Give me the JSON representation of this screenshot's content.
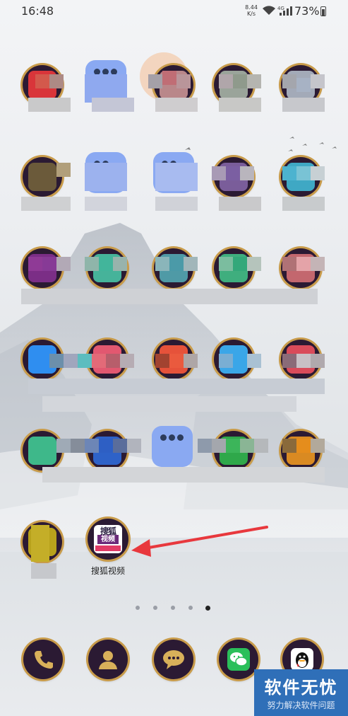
{
  "status_bar": {
    "time": "16:48",
    "net_speed_value": "8.44",
    "net_speed_unit": "K/s",
    "network": "4G",
    "battery": "73%"
  },
  "home": {
    "highlighted_app": {
      "label": "搜狐视频",
      "icon_text_top": "搜狐",
      "icon_text_mid": "视频"
    },
    "page_indicator": {
      "count": 5,
      "active_index": 5
    }
  },
  "dock": {
    "items": [
      {
        "name": "phone-icon"
      },
      {
        "name": "contacts-icon"
      },
      {
        "name": "messages-icon"
      },
      {
        "name": "wechat-icon"
      },
      {
        "name": "qq-icon"
      }
    ]
  },
  "watermark": {
    "title": "软件无忧",
    "subtitle": "努力解决软件问题"
  },
  "colors": {
    "arrow": "#e8383d",
    "icon_ring": "#c89b4a",
    "icon_bg": "#2b1a33",
    "watermark_bg": "#2f6fb8"
  }
}
